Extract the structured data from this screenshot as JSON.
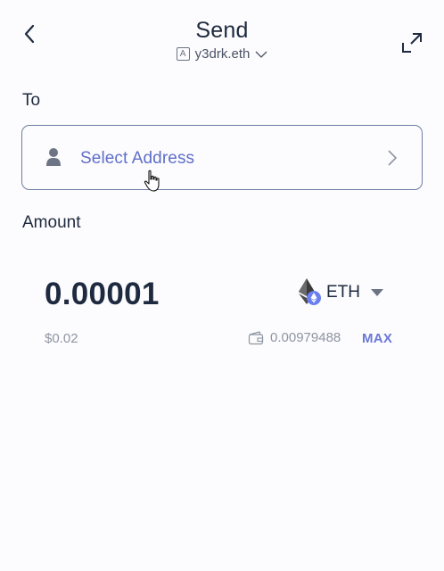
{
  "header": {
    "title": "Send",
    "account_badge": "A",
    "account_name": "y3drk.eth"
  },
  "to": {
    "label": "To",
    "select_address_label": "Select Address"
  },
  "amount": {
    "label": "Amount",
    "value": "0.00001",
    "fiat_value": "$0.02",
    "token_symbol": "ETH",
    "balance": "0.00979488",
    "max_label": "MAX"
  },
  "colors": {
    "background": "#fcfbfd",
    "text_primary": "#1e2a3f",
    "accent": "#5f6fc9",
    "muted": "#8e95a3",
    "border": "#6f7ea4"
  },
  "icons": {
    "back": "chevron-left-icon",
    "expand": "expand-icon",
    "account_chevron": "chevron-down-icon",
    "person": "person-icon",
    "address_chevron": "chevron-right-icon",
    "token": "eth-icon",
    "token_caret": "caret-down-icon",
    "wallet": "wallet-icon",
    "cursor": "hand-cursor-icon"
  }
}
